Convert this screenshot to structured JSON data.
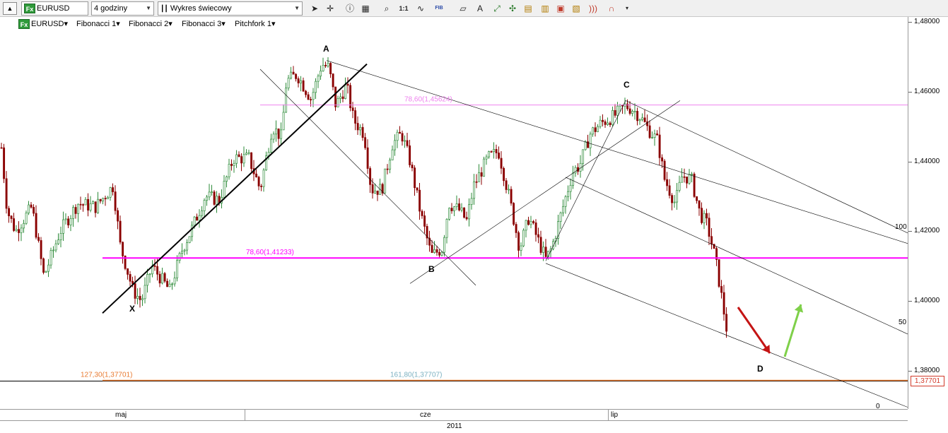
{
  "toolbar": {
    "symbol": "EURUSD",
    "timeframe": "4 godziny",
    "chart_type": "Wykres świecowy",
    "tools": [
      "cursor-icon",
      "crosshair-icon",
      "info-icon",
      "grid-icon",
      "zoom-icon",
      "one-to-one-icon",
      "wave-icon",
      "fibonacci-icon",
      "eraser-icon",
      "text-icon",
      "pattern-icon",
      "fan-icon",
      "grid2-icon",
      "chart-style-icon",
      "ruler-icon",
      "wave2-icon",
      "magnet-icon",
      "more-icon"
    ],
    "one_to_one": "1:1",
    "fib": "FIB"
  },
  "header": {
    "symbol": "EURUSD",
    "fibonacci_1": "Fibonacci 1",
    "fibonacci_2": "Fibonacci 2",
    "fibonacci_3": "Fibonacci 3",
    "pitchfork_1": "Pitchfork 1"
  },
  "chart_data": {
    "type": "candlestick",
    "instrument": "EURUSD",
    "y_ticks": [
      "1,48000",
      "1,46000",
      "1,44000",
      "1,42000",
      "1,40000",
      "1,38000"
    ],
    "ylim": [
      1.369,
      1.4815
    ],
    "x_labels": [
      "maj",
      "cze",
      "lip"
    ],
    "year_label": "2011",
    "current_price": "1,37701",
    "points": {
      "X": 1.3985,
      "A": 1.4695,
      "B": 1.4075,
      "C": 1.4575,
      "D": 1.3775
    },
    "point_labels": [
      "X",
      "A",
      "B",
      "C",
      "D"
    ],
    "fib_levels": [
      {
        "label": "78,60(1,45624)",
        "price": 1.45624,
        "color": "#ee82ee"
      },
      {
        "label": "78,60(1,41233)",
        "price": 1.41233,
        "color": "#ff00ff"
      },
      {
        "label": "127,30(1,37701)",
        "price": 1.37701,
        "color": "#e87a30"
      },
      {
        "label": "161,80(1,37707)",
        "price": 1.37707,
        "color": "#7ab0c0"
      }
    ],
    "pitchfork_levels": [
      "100",
      "50",
      "0"
    ],
    "colors": {
      "up": "#2e8b3a",
      "down": "#8b0000",
      "arrow_down": "#c41414",
      "arrow_up": "#7fd04a"
    }
  }
}
